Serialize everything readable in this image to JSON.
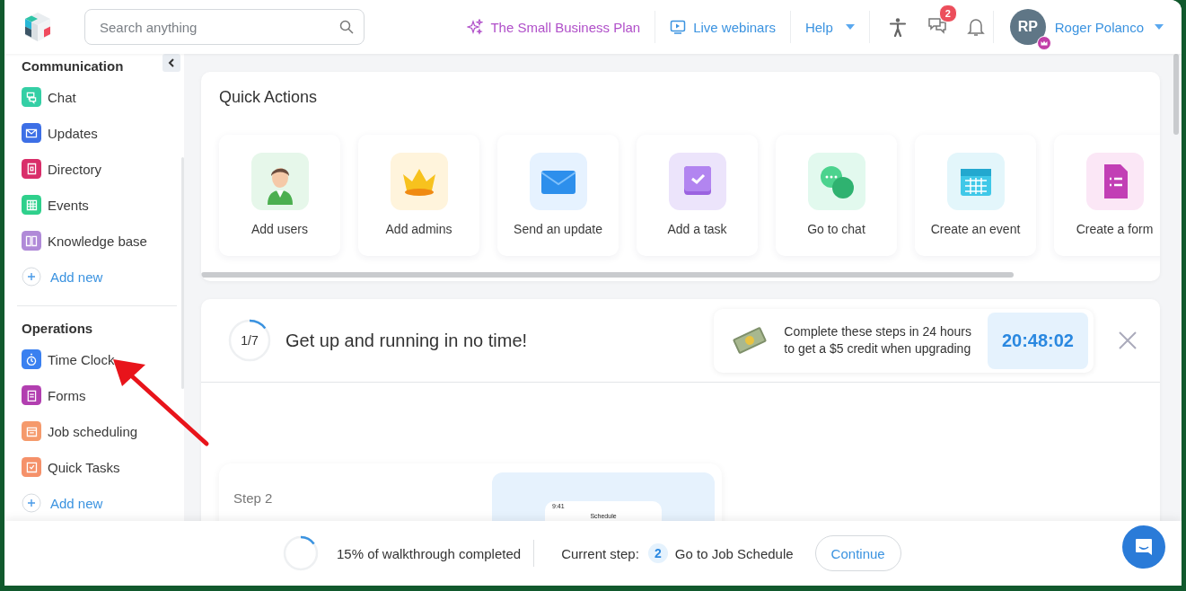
{
  "header": {
    "search": {
      "placeholder": "Search anything"
    },
    "nav": [
      {
        "label": "The Small Business Plan",
        "kind": "plan"
      },
      {
        "label": "Live webinars",
        "kind": "webinar"
      },
      {
        "label": "Help",
        "kind": "dropdown"
      }
    ],
    "chat_badge": "2",
    "user": {
      "initials": "RP",
      "name": "Roger Polanco"
    }
  },
  "sidebar": {
    "sections": [
      {
        "title": "Communication",
        "items": [
          {
            "label": "Chat",
            "kind": "app",
            "color": "#34cfa5"
          },
          {
            "label": "Updates",
            "kind": "app",
            "color": "#3d6fe6"
          },
          {
            "label": "Directory",
            "kind": "app",
            "color": "#d92e6a"
          },
          {
            "label": "Events",
            "kind": "app",
            "color": "#2fd08c"
          },
          {
            "label": "Knowledge base",
            "kind": "app",
            "color": "#b08ad8"
          },
          {
            "label": "Add new",
            "kind": "add"
          }
        ]
      },
      {
        "title": "Operations",
        "items": [
          {
            "label": "Time Clock",
            "kind": "app",
            "color": "#3a80f0"
          },
          {
            "label": "Forms",
            "kind": "app",
            "color": "#b23fb0"
          },
          {
            "label": "Job scheduling",
            "kind": "app",
            "color": "#f59a6c"
          },
          {
            "label": "Quick Tasks",
            "kind": "app",
            "color": "#f5916a"
          },
          {
            "label": "Add new",
            "kind": "add"
          }
        ]
      }
    ]
  },
  "quick_actions": {
    "title": "Quick Actions",
    "items": [
      {
        "label": "Add users",
        "color": "#e6f7ea"
      },
      {
        "label": "Add admins",
        "color": "#fff4dc"
      },
      {
        "label": "Send an update",
        "color": "#e6f2ff"
      },
      {
        "label": "Add a task",
        "color": "#ece4fb"
      },
      {
        "label": "Go to chat",
        "color": "#e2f9ee"
      },
      {
        "label": "Create an event",
        "color": "#e3f6fb"
      },
      {
        "label": "Create a form",
        "color": "#fbe7f6"
      }
    ]
  },
  "onboarding": {
    "step_counter": "1/7",
    "level": 0.143,
    "title": "Get up and running in no time!",
    "promo_lines": [
      "Complete these steps in 24 hours",
      "to get a $5 credit when upgrading"
    ],
    "timer": "20:48:02",
    "step_card": {
      "label": "Step 2",
      "phone_time": "9:41",
      "phone_title": "Schedule"
    }
  },
  "walkthrough": {
    "level": 0.15,
    "progress_text": "15% of walkthrough completed",
    "current_step_label": "Current step:",
    "step_number": "2",
    "step_title": "Go to Job Schedule",
    "button": "Continue"
  }
}
